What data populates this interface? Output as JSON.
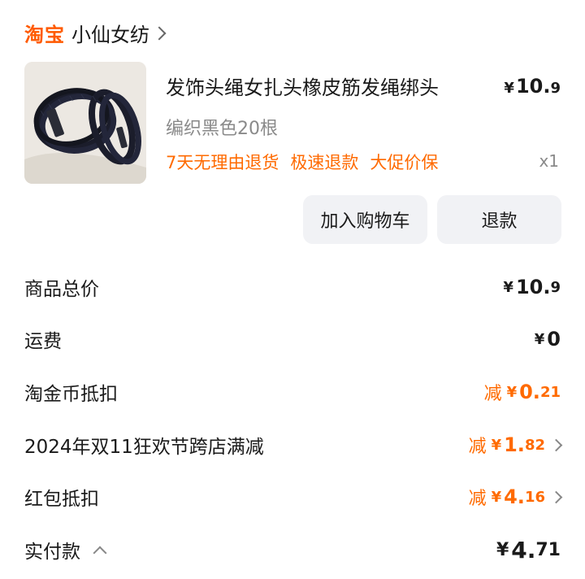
{
  "shop": {
    "brand": "淘宝",
    "name": "小仙女纺"
  },
  "item": {
    "title": "发饰头绳女扎头橡皮筋发绳绑头",
    "price_yen": "¥",
    "price_int": "10.",
    "price_dec": "9",
    "sku": "编织黑色20根",
    "tags": [
      "7天无理由退货",
      "极速退款",
      "大促价保"
    ],
    "quantity": "x1"
  },
  "actions": {
    "add_cart": "加入购物车",
    "refund": "退款"
  },
  "summary": {
    "subtotal": {
      "label": "商品总价",
      "yen": "¥",
      "int": "10.",
      "dec": "9"
    },
    "shipping": {
      "label": "运费",
      "yen": "¥",
      "int": "0"
    },
    "coins": {
      "label": "淘金币抵扣",
      "minus": "减",
      "yen": "¥",
      "int": "0.",
      "dec": "21"
    },
    "promo": {
      "label": "2024年双11狂欢节跨店满减",
      "minus": "减",
      "yen": "¥",
      "int": "1.",
      "dec": "82"
    },
    "redpacket": {
      "label": "红包抵扣",
      "minus": "减",
      "yen": "¥",
      "int": "4.",
      "dec": "16"
    },
    "paid": {
      "label": "实付款",
      "yen": "¥",
      "int": "4.",
      "dec": "71"
    }
  },
  "colors": {
    "accent": "#ff6a00",
    "brand": "#ff5a00",
    "button_bg": "#f1f2f5"
  }
}
